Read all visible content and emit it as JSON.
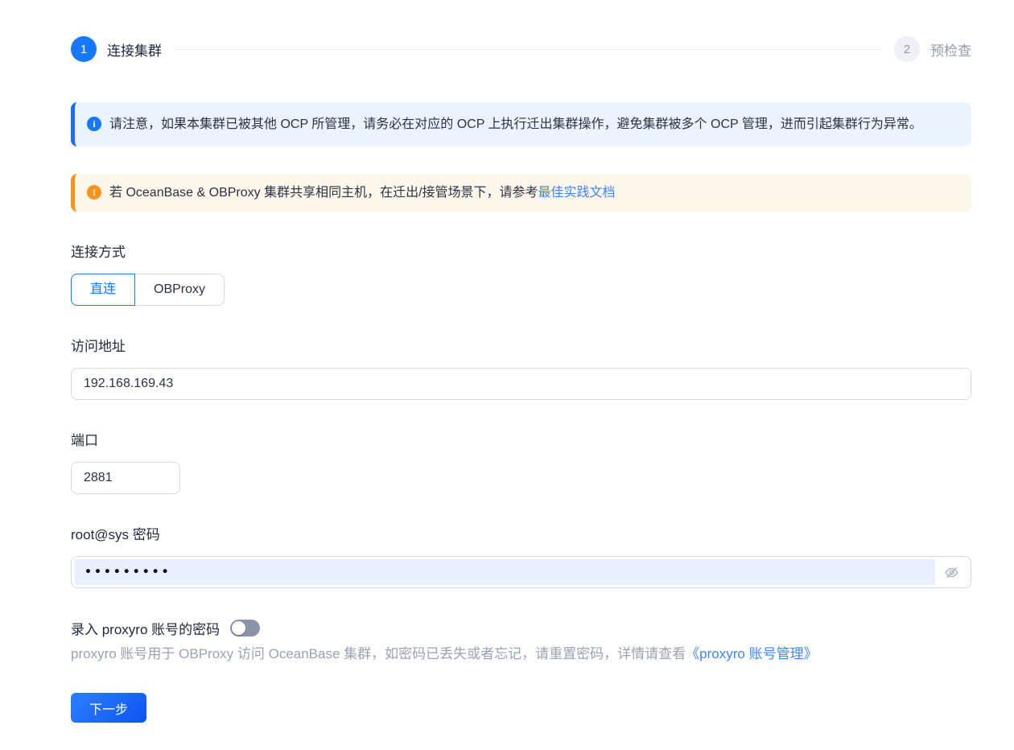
{
  "steps": {
    "items": [
      {
        "number": "1",
        "label": "连接集群",
        "state": "current"
      },
      {
        "number": "2",
        "label": "预检查",
        "state": "wait"
      }
    ]
  },
  "alerts": {
    "info": {
      "text": "请注意，如果本集群已被其他 OCP 所管理，请务必在对应的 OCP 上执行迁出集群操作，避免集群被多个 OCP 管理，进而引起集群行为异常。"
    },
    "warning": {
      "text": "若 OceanBase & OBProxy 集群共享相同主机，在迁出/接管场景下，请参考",
      "link_text": "最佳实践文档"
    }
  },
  "form": {
    "connection_method": {
      "label": "连接方式",
      "options": [
        {
          "label": "直连",
          "selected": true
        },
        {
          "label": "OBProxy",
          "selected": false
        }
      ]
    },
    "address": {
      "label": "访问地址",
      "value": "192.168.169.43"
    },
    "port": {
      "label": "端口",
      "value": "2881"
    },
    "password": {
      "label": "root@sys 密码",
      "masked_value": "•••••••••"
    },
    "proxyro": {
      "label": "录入 proxyro 账号的密码",
      "switch_on": false,
      "help_text": "proxyro 账号用于 OBProxy 访问 OceanBase 集群，如密码已丢失或者忘记，请重置密码，详情请查看",
      "help_link_text": "《proxyro 账号管理》"
    }
  },
  "actions": {
    "next_label": "下一步"
  },
  "icons": {
    "info": "info-circle-filled",
    "warning": "exclamation-circle-filled",
    "password_suffix": "eye-invisible"
  },
  "colors": {
    "primary": "#1677ff",
    "warning_accent": "#f7941e",
    "info_bg": "#ebf3ff",
    "warning_bg": "#fdf6ea",
    "autofill_bg": "#e8f0fe",
    "button_gradient_start": "#2e7eff",
    "button_gradient_end": "#0c55f0",
    "link": "#3d85ff"
  }
}
